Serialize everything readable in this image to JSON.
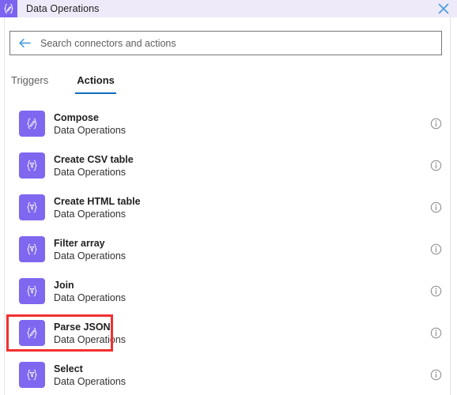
{
  "header": {
    "icon": "data-operations-braces-icon",
    "title": "Data Operations",
    "close_label": "✕",
    "background": "#eeeaf9",
    "icon_background": "#7c63f0",
    "close_color": "#4a9ae0"
  },
  "search": {
    "back_icon": "back-arrow-icon",
    "placeholder": "Search connectors and actions",
    "value": ""
  },
  "tabs": [
    {
      "label": "Triggers",
      "active": false
    },
    {
      "label": "Actions",
      "active": true
    }
  ],
  "accent": {
    "tab_underline": "#0f6cbd",
    "tile_purple": "#8067f0",
    "highlight_red": "#f33030"
  },
  "list": {
    "info_icon": "info-circle-icon",
    "items": [
      {
        "title": "Compose",
        "subtitle": "Data Operations",
        "glyph": "braces-pencil-icon",
        "highlighted": false
      },
      {
        "title": "Create CSV table",
        "subtitle": "Data Operations",
        "glyph": "braces-funnel-icon",
        "highlighted": false
      },
      {
        "title": "Create HTML table",
        "subtitle": "Data Operations",
        "glyph": "braces-funnel-icon",
        "highlighted": false
      },
      {
        "title": "Filter array",
        "subtitle": "Data Operations",
        "glyph": "braces-funnel-icon",
        "highlighted": false
      },
      {
        "title": "Join",
        "subtitle": "Data Operations",
        "glyph": "braces-funnel-icon",
        "highlighted": false
      },
      {
        "title": "Parse JSON",
        "subtitle": "Data Operations",
        "glyph": "braces-pencil-icon",
        "highlighted": true
      },
      {
        "title": "Select",
        "subtitle": "Data Operations",
        "glyph": "braces-funnel-icon",
        "highlighted": false
      }
    ]
  }
}
